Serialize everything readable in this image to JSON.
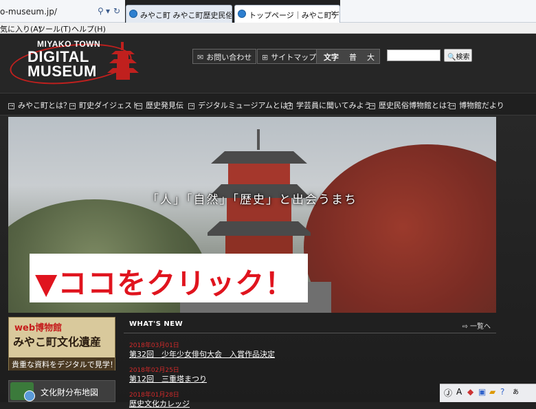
{
  "browser": {
    "address_url": "o-museum.jp/",
    "tabs": [
      {
        "label": "みやこ町 みやこ町歴史民俗博物館"
      },
      {
        "label": "トップページ｜みやこ町デジタ..."
      }
    ],
    "menu": [
      "気に入り(A)",
      "ツール(T)",
      "ヘルプ(H)"
    ]
  },
  "site": {
    "logo": {
      "top": "MIYAKO TOWN",
      "line1": "DIGITAL",
      "line2": "MUSEUM"
    },
    "header": {
      "contact": "お問い合わせ",
      "sitemap": "サイトマップ",
      "fontsize_label": "文字",
      "fontsize_normal": "普",
      "fontsize_large": "大",
      "search_button": "検索"
    },
    "nav": [
      "みやこ町とは？",
      "町史ダイジェスト",
      "歴史発見伝",
      "デジタルミュージアムとは？",
      "学芸員に聞いてみよう",
      "歴史民俗博物館とは？",
      "博物館だより"
    ],
    "hero": {
      "tagline": "「人」「自然」「歴史」と出会うまち"
    },
    "callout": "▼ココをクリック！",
    "banner": {
      "sub": "web博物館",
      "title": "みやこ町文化遺産",
      "caption": "貴重な資料をデジタルで見学！"
    },
    "bunka": "文化財分布地図",
    "news": {
      "heading": "WHAT'S NEW",
      "more": "一覧へ",
      "items": [
        {
          "date": "2018年03月01日",
          "title": "第32回　少年少女俳句大会　入賞作品決定"
        },
        {
          "date": "2018年02月25日",
          "title": "第12回　三重塔まつり"
        },
        {
          "date": "2018年01月28日",
          "title": "歴史文化カレッジ"
        }
      ]
    }
  }
}
